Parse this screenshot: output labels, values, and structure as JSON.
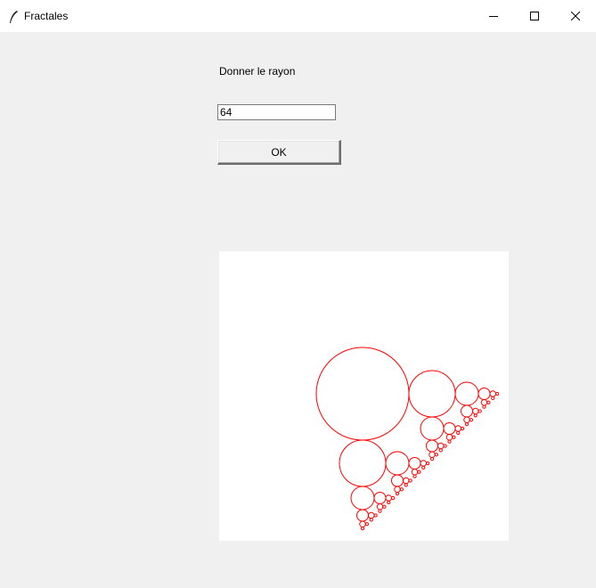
{
  "window": {
    "title": "Fractales",
    "icon": "feather-icon",
    "controls": [
      "minimize-icon",
      "maximize-icon",
      "close-icon"
    ]
  },
  "form": {
    "prompt_label": "Donner le rayon",
    "radius_value": "64",
    "ok_label": "OK"
  },
  "canvas": {
    "background": "#ffffff",
    "stroke_color": "#ff0000",
    "radius": 64
  }
}
